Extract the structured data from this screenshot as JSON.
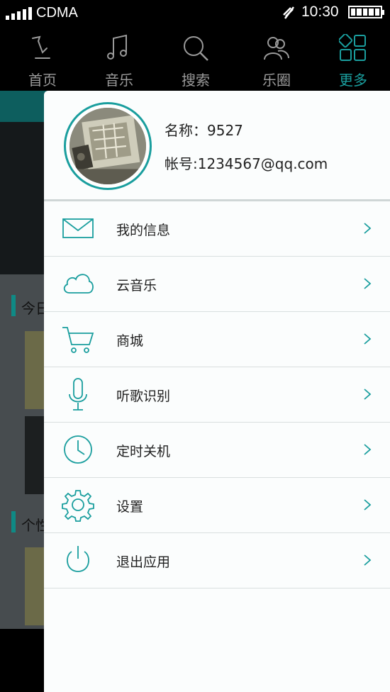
{
  "status_bar": {
    "carrier": "CDMA",
    "time": "10:30"
  },
  "nav": {
    "items": [
      {
        "label": "首页",
        "icon": "home-icon"
      },
      {
        "label": "音乐",
        "icon": "music-note-icon"
      },
      {
        "label": "搜索",
        "icon": "search-icon"
      },
      {
        "label": "乐圈",
        "icon": "people-icon"
      },
      {
        "label": "更多",
        "icon": "grid-icon"
      }
    ],
    "active_index": 4,
    "active_color": "#1a9e9e"
  },
  "background": {
    "section1": "今日",
    "section2": "个性"
  },
  "drawer": {
    "profile": {
      "name": "名称：9527",
      "account": "帐号:1234567@qq.com"
    },
    "menu": [
      {
        "label": "我的信息",
        "icon": "mail-icon"
      },
      {
        "label": "云音乐",
        "icon": "cloud-icon"
      },
      {
        "label": "商城",
        "icon": "cart-icon"
      },
      {
        "label": "听歌识别",
        "icon": "microphone-icon"
      },
      {
        "label": "定时关机",
        "icon": "clock-icon"
      },
      {
        "label": "设置",
        "icon": "gear-icon"
      },
      {
        "label": "退出应用",
        "icon": "power-icon"
      }
    ]
  }
}
